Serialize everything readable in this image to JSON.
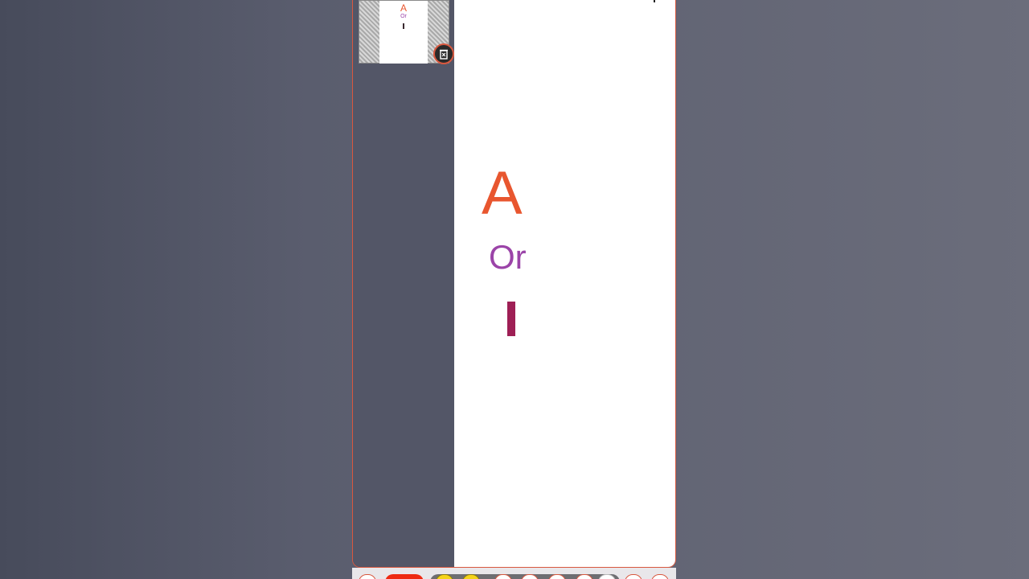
{
  "sidebar": {
    "thumbnail": {
      "letter_a": "A",
      "letter_or": "Or",
      "delete_icon": "delete-slide-icon"
    }
  },
  "canvas": {
    "letter_a": "A",
    "letter_or": "Or",
    "letter_i_shape": "vertical-bar"
  },
  "colors": {
    "accent_orange": "#e8562f",
    "purple": "#9b44a8",
    "crimson": "#9e1f55",
    "toolbar_red": "#ee2a12",
    "toolbar_yellow": "#f5d41a"
  },
  "toolbar": {
    "icons": [
      "tool-icon",
      "red-tool-icon",
      "yellow-tool-icon",
      "yellow-tool-icon",
      "tool-icon",
      "tool-icon",
      "tool-icon",
      "tool-icon",
      "tool-icon",
      "tool-icon",
      "tool-icon"
    ]
  }
}
